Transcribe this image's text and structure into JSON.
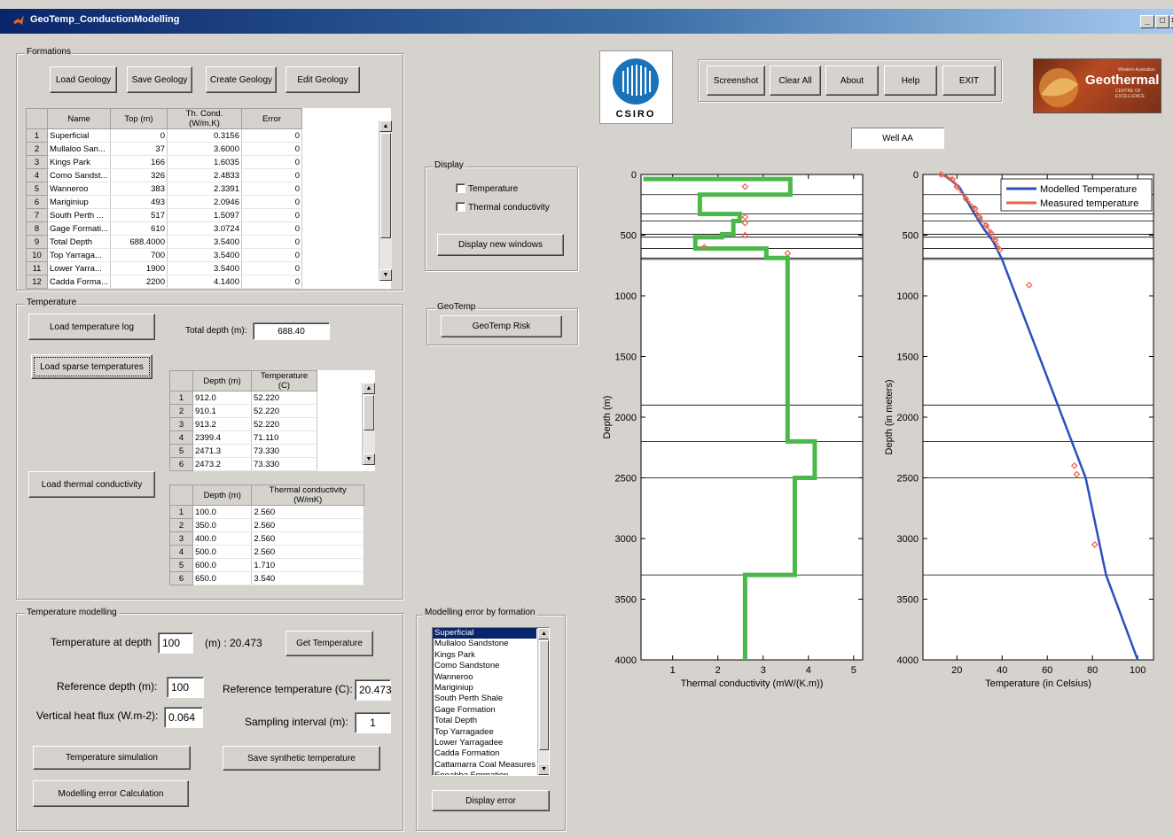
{
  "window": {
    "title": "GeoTemp_ConductionModelling",
    "min": "_",
    "max": "□",
    "close": "×"
  },
  "formations": {
    "group_label": "Formations",
    "buttons": {
      "load": "Load Geology",
      "save": "Save Geology",
      "create": "Create Geology",
      "edit": "Edit Geology"
    },
    "headers": [
      "Name",
      "Top (m)",
      "Th. Cond. (W/m.K)",
      "Error"
    ],
    "rows": [
      {
        "n": "1",
        "name": "Superficial",
        "top": "0",
        "cond": "0.3156",
        "err": "0"
      },
      {
        "n": "2",
        "name": "Mullaloo San...",
        "top": "37",
        "cond": "3.6000",
        "err": "0"
      },
      {
        "n": "3",
        "name": "Kings Park",
        "top": "166",
        "cond": "1.6035",
        "err": "0"
      },
      {
        "n": "4",
        "name": "Como Sandst...",
        "top": "326",
        "cond": "2.4833",
        "err": "0"
      },
      {
        "n": "5",
        "name": "Wanneroo",
        "top": "383",
        "cond": "2.3391",
        "err": "0"
      },
      {
        "n": "6",
        "name": "Mariginiup",
        "top": "493",
        "cond": "2.0946",
        "err": "0"
      },
      {
        "n": "7",
        "name": "South Perth ...",
        "top": "517",
        "cond": "1.5097",
        "err": "0"
      },
      {
        "n": "8",
        "name": "Gage Formati...",
        "top": "610",
        "cond": "3.0724",
        "err": "0"
      },
      {
        "n": "9",
        "name": "Total Depth",
        "top": "688.4000",
        "cond": "3.5400",
        "err": "0"
      },
      {
        "n": "10",
        "name": "Top Yarraga...",
        "top": "700",
        "cond": "3.5400",
        "err": "0"
      },
      {
        "n": "11",
        "name": "Lower Yarra...",
        "top": "1900",
        "cond": "3.5400",
        "err": "0"
      },
      {
        "n": "12",
        "name": "Cadda Forma...",
        "top": "2200",
        "cond": "4.1400",
        "err": "0"
      }
    ]
  },
  "temperature": {
    "group_label": "Temperature",
    "load_log": "Load temperature log",
    "load_sparse": "Load sparse temperatures",
    "load_cond": "Load thermal conductivity",
    "total_depth_label": "Total depth (m):",
    "total_depth_value": "688.40",
    "temp_headers": [
      "Depth (m)",
      "Temperature (C)"
    ],
    "temp_rows": [
      {
        "n": "1",
        "d": "912.0",
        "t": "52.220"
      },
      {
        "n": "2",
        "d": "910.1",
        "t": "52.220"
      },
      {
        "n": "3",
        "d": "913.2",
        "t": "52.220"
      },
      {
        "n": "4",
        "d": "2399.4",
        "t": "71.110"
      },
      {
        "n": "5",
        "d": "2471.3",
        "t": "73.330"
      },
      {
        "n": "6",
        "d": "2473.2",
        "t": "73.330"
      }
    ],
    "cond_headers": [
      "Depth (m)",
      "Thermal conductivity (W/mK)"
    ],
    "cond_rows": [
      {
        "n": "1",
        "d": "100.0",
        "c": "2.560"
      },
      {
        "n": "2",
        "d": "350.0",
        "c": "2.560"
      },
      {
        "n": "3",
        "d": "400.0",
        "c": "2.560"
      },
      {
        "n": "4",
        "d": "500.0",
        "c": "2.560"
      },
      {
        "n": "5",
        "d": "600.0",
        "c": "1.710"
      },
      {
        "n": "6",
        "d": "650.0",
        "c": "3.540"
      }
    ]
  },
  "modelling": {
    "group_label": "Temperature modelling",
    "temp_at_depth_label": "Temperature at depth",
    "temp_at_depth_value": "100",
    "temp_at_depth_result": "(m) : 20.473",
    "get_temperature": "Get Temperature",
    "ref_depth_label": "Reference depth (m):",
    "ref_depth_value": "100",
    "ref_temp_label": "Reference temperature (C):",
    "ref_temp_value": "20.473",
    "heat_flux_label": "Vertical heat flux (W.m-2):",
    "heat_flux_value": "0.064",
    "sampling_label": "Sampling interval (m):",
    "sampling_value": "1",
    "simulation": "Temperature simulation",
    "save_synthetic": "Save synthetic temperature",
    "error_calc": "Modelling error Calculation"
  },
  "display": {
    "group_label": "Display",
    "temperature_cb": "Temperature",
    "conductivity_cb": "Thermal conductivity",
    "new_windows": "Display new windows"
  },
  "geotemp": {
    "group_label": "GeoTemp",
    "risk": "GeoTemp Risk"
  },
  "error_by_formation": {
    "group_label": "Modelling error by formation",
    "items": [
      "Superficial",
      "Mullaloo Sandstone",
      "Kings Park",
      "Como Sandstone",
      "Wanneroo",
      "Mariginiup",
      "South Perth Shale",
      "Gage Formation",
      "Total Depth",
      "Top Yarragadee",
      "Lower Yarragadee",
      "Cadda Formation",
      "Cattamarra Coal Measures",
      "Eneabba Formation"
    ],
    "selected": "Superficial",
    "display_error": "Display error"
  },
  "toolbar": {
    "screenshot": "Screenshot",
    "clear": "Clear All",
    "about": "About",
    "help": "Help",
    "exit": "EXIT"
  },
  "logos": {
    "csiro": "CSIRO",
    "geothermal": "Geothermal",
    "geothermal_top": "Western Australian",
    "geothermal_sub": "CENTRE OF EXCELLENCE"
  },
  "well_name": "Well AA",
  "colors": {
    "conductivity": "#4cb84c",
    "modelled": "#2b4fbf",
    "measured": "#e8634a",
    "title_start": "#0a246a",
    "face": "#d6d3ce"
  },
  "chart_data": [
    {
      "type": "line",
      "xlabel": "Thermal conductivity (mW/(K.m))",
      "ylabel": "Depth (m)",
      "xlim": [
        0.3,
        5.2
      ],
      "ylim": [
        4000,
        0
      ],
      "xticks": [
        1,
        2,
        3,
        4,
        5
      ],
      "yticks": [
        0,
        500,
        1000,
        1500,
        2000,
        2500,
        3000,
        3500,
        4000
      ],
      "formation_tops": [
        0,
        166,
        326,
        383,
        493,
        517,
        610,
        688.4,
        700,
        1900,
        2200,
        2500,
        3300
      ],
      "series": [
        {
          "x": [
            0.35,
            3.6,
            3.6,
            1.6,
            1.6,
            2.48,
            2.48,
            2.34,
            2.34,
            2.09,
            2.09,
            1.5,
            1.5,
            3.07,
            3.07,
            3.54,
            3.54,
            4.14,
            4.14,
            3.7,
            3.7,
            2.6,
            2.6
          ],
          "y": [
            37,
            37,
            166,
            166,
            326,
            326,
            383,
            383,
            493,
            493,
            517,
            517,
            610,
            610,
            688,
            688,
            2200,
            2200,
            2500,
            2500,
            3300,
            3300,
            4000
          ]
        },
        {
          "x": [
            2.6,
            2.6,
            2.6,
            2.6,
            1.7,
            3.54
          ],
          "y": [
            100,
            350,
            400,
            500,
            600,
            650
          ]
        }
      ]
    },
    {
      "type": "line",
      "xlabel": "Temperature (in Celsius)",
      "ylabel": "Depth (in meters)",
      "xlim": [
        5,
        107
      ],
      "ylim": [
        4000,
        0
      ],
      "xticks": [
        20,
        40,
        60,
        80,
        100
      ],
      "yticks": [
        0,
        500,
        1000,
        1500,
        2000,
        2500,
        3000,
        3500,
        4000
      ],
      "formation_tops": [
        0,
        166,
        326,
        383,
        493,
        517,
        610,
        688.4,
        700,
        1900,
        2200,
        2500,
        3300
      ],
      "legend_position": "top-right",
      "series": [
        {
          "name": "Modelled Temperature",
          "x": [
            14,
            21,
            27,
            32,
            36,
            40,
            77,
            86,
            100
          ],
          "y": [
            0,
            100,
            300,
            450,
            550,
            700,
            2500,
            3300,
            4000
          ]
        },
        {
          "name": "Measured temperature",
          "x": [
            13,
            18,
            20,
            24,
            28,
            30,
            33,
            35,
            37,
            39,
            52,
            72,
            73,
            81
          ],
          "y": [
            0,
            40,
            100,
            200,
            280,
            350,
            420,
            480,
            540,
            620,
            912,
            2400,
            2471,
            3050
          ]
        }
      ]
    }
  ]
}
